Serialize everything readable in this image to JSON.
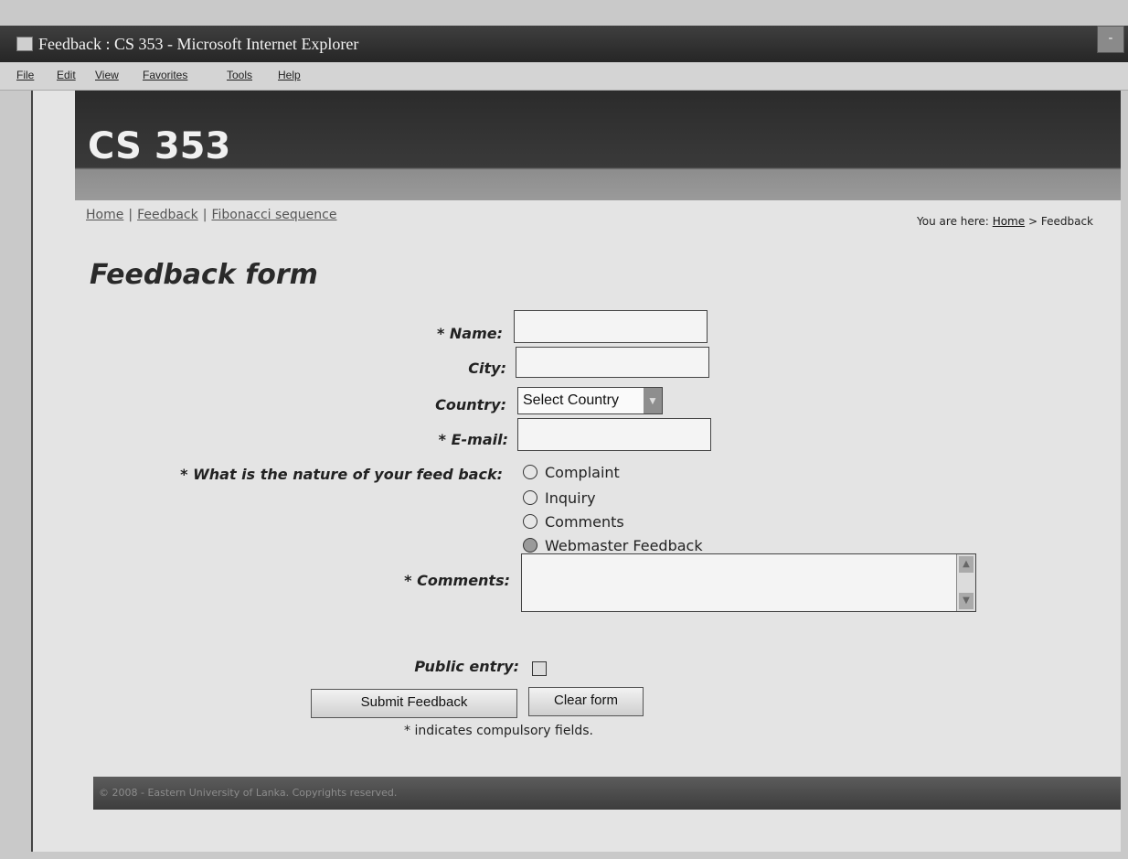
{
  "window": {
    "title": "Feedback : CS 353 - Microsoft Internet Explorer",
    "minimize_label": "-"
  },
  "menubar": [
    "File",
    "Edit",
    "View",
    "Favorites",
    "Tools",
    "Help"
  ],
  "site": {
    "title": "CS 353",
    "nav": [
      "Home",
      "Feedback",
      "Fibonacci sequence"
    ],
    "nav_separator": "|",
    "breadcrumb_prefix": "You are here:",
    "breadcrumb_home": "Home",
    "breadcrumb_sep": ">",
    "breadcrumb_current": "Feedback"
  },
  "form": {
    "heading": "Feedback form",
    "name_label": "* Name:",
    "city_label": "City:",
    "country_label": "Country:",
    "country_selected": "Select Country",
    "email_label": "* E-mail:",
    "nature_label": "* What is the nature of your feed back:",
    "nature_options": [
      "Complaint",
      "Inquiry",
      "Comments",
      "Webmaster Feedback"
    ],
    "comments_label": "* Comments:",
    "public_label": "Public entry:",
    "submit_label": "Submit Feedback",
    "clear_label": "Clear form",
    "note": "* indicates compulsory fields."
  },
  "footer": {
    "text": "© 2008 - Eastern University of Lanka. Copyrights reserved."
  }
}
